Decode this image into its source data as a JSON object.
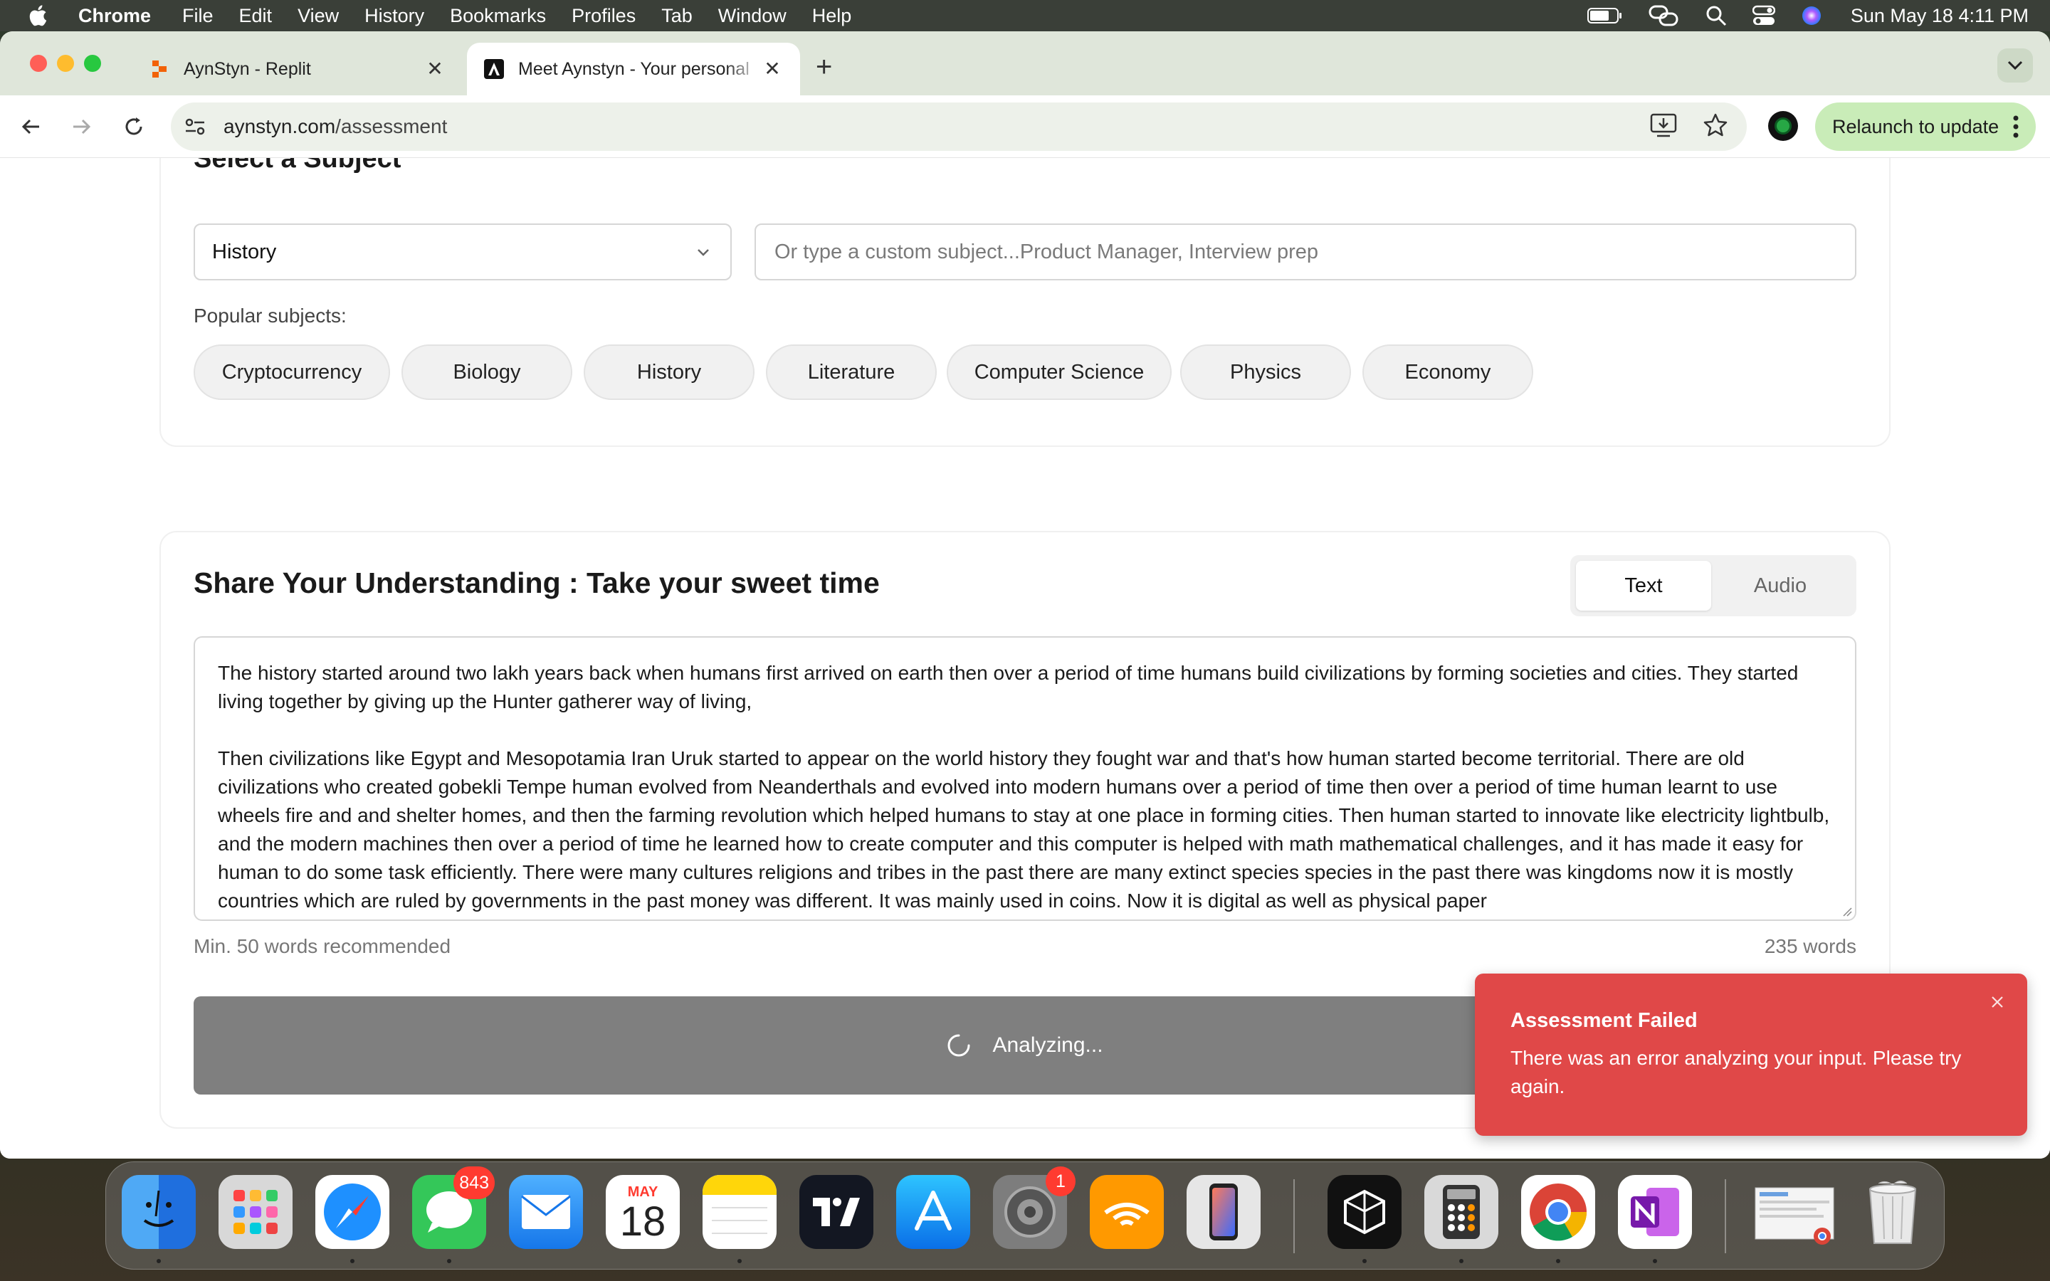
{
  "menubar": {
    "app_name": "Chrome",
    "items": [
      "File",
      "Edit",
      "View",
      "History",
      "Bookmarks",
      "Profiles",
      "Tab",
      "Window",
      "Help"
    ],
    "clock": "Sun May 18  4:11 PM"
  },
  "browser": {
    "tabs": [
      {
        "title": "AynStyn - Replit",
        "favicon": "replit-icon",
        "active": false
      },
      {
        "title": "Meet Aynstyn - Your personal",
        "favicon": "aynstyn-icon",
        "active": true
      }
    ],
    "url_host": "aynstyn.com",
    "url_path": "/assessment",
    "relaunch_label": "Relaunch to update"
  },
  "subject": {
    "heading_partial": "Select a Subject",
    "selected": "History",
    "custom_placeholder": "Or type a custom subject...Product Manager, Interview prep",
    "popular_label": "Popular subjects:",
    "popular": [
      "Cryptocurrency",
      "Biology",
      "History",
      "Literature",
      "Computer Science",
      "Physics",
      "Economy"
    ]
  },
  "understanding": {
    "title": "Share Your Understanding : Take your sweet time",
    "modes": [
      "Text",
      "Audio"
    ],
    "active_mode": "Text",
    "paragraph1": "The history started around two lakh years back when humans first arrived on earth then over a period of time humans build civilizations by forming societies and cities. They started living together by giving up the Hunter gatherer way of living,",
    "paragraph2": "Then civilizations like Egypt and Mesopotamia Iran Uruk started to appear on the world history they fought war and that's how human started become territorial. There are old civilizations who created gobekli Tempe human evolved from Neanderthals and evolved into modern humans over a period of time then over a period of time human learnt to use wheels fire and and shelter homes, and then the farming revolution which helped humans to stay at one place in forming cities. Then human started to innovate like electricity lightbulb, and the modern machines then over a period of time he learned how to create computer and this computer is helped with math mathematical challenges, and it has made it easy for human to do some task efficiently. There were many cultures religions and tribes in the past there are many extinct species species in the past there was kingdoms now it is mostly countries which are ruled by governments in the past money was different. It was mainly used in coins. Now it is digital as well as physical paper",
    "min_hint": "Min. 50 words recommended",
    "word_count": "235 words",
    "analyze_label": "Analyzing..."
  },
  "toast": {
    "title": "Assessment Failed",
    "message": "There was an error analyzing your input. Please try again."
  },
  "dock": {
    "apps": [
      "Finder",
      "Launchpad",
      "Safari",
      "Messages",
      "Mail",
      "Calendar",
      "Notes",
      "TradingView",
      "App Store",
      "System Settings",
      "Audible",
      "iPhone Mirroring",
      "Perplexity",
      "Calculator",
      "Google Chrome",
      "OneNote",
      "Downloads",
      "Trash"
    ],
    "messages_badge": "843",
    "settings_badge": "1",
    "calendar_month": "MAY",
    "calendar_day": "18"
  },
  "colors": {
    "toast_bg": "#e04848",
    "analyze_bg": "#7f7f7f",
    "relaunch_bg": "#c9ecb8",
    "tabstrip_bg": "#dfe6da"
  }
}
